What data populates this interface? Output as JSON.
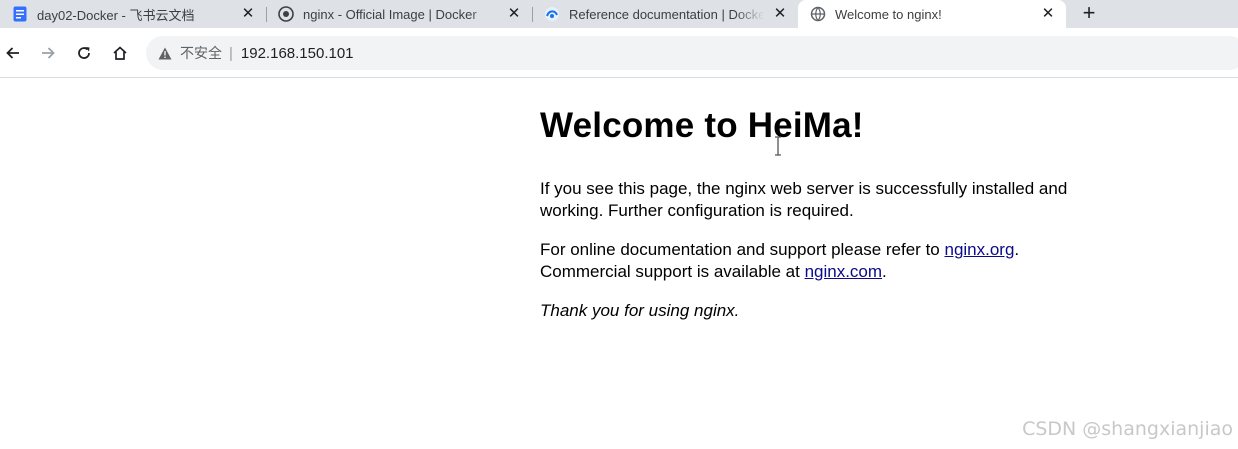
{
  "tabs": [
    {
      "title": "day02-Docker - 飞书云文档",
      "favicon": "document-icon",
      "active": false,
      "close": "✕"
    },
    {
      "title": "nginx - Official Image | Docker",
      "favicon": "globe-icon",
      "active": false,
      "close": "✕"
    },
    {
      "title": "Reference documentation | Docker",
      "favicon": "docs-icon",
      "active": false,
      "close": "✕"
    },
    {
      "title": "Welcome to nginx!",
      "favicon": "world-icon",
      "active": true,
      "close": "✕"
    }
  ],
  "new_tab": "+",
  "toolbar": {
    "security_label": "不安全",
    "separator": "|",
    "url": "192.168.150.101"
  },
  "page": {
    "heading": "Welcome to HeiMa!",
    "para1": "If you see this page, the nginx web server is successfully installed and working. Further configuration is required.",
    "para2_prefix": "For online documentation and support please refer to ",
    "link_org": "nginx.org",
    "para2_mid": ".",
    "para2_line2_prefix": "Commercial support is available at ",
    "link_com": "nginx.com",
    "para2_suffix": ".",
    "thanks": "Thank you for using nginx."
  },
  "watermark": "CSDN @shangxianjiao",
  "colors": {
    "tabstrip": "#dee1e6",
    "link": "#0a0a8a",
    "doc_favicon": "#3370ff"
  }
}
